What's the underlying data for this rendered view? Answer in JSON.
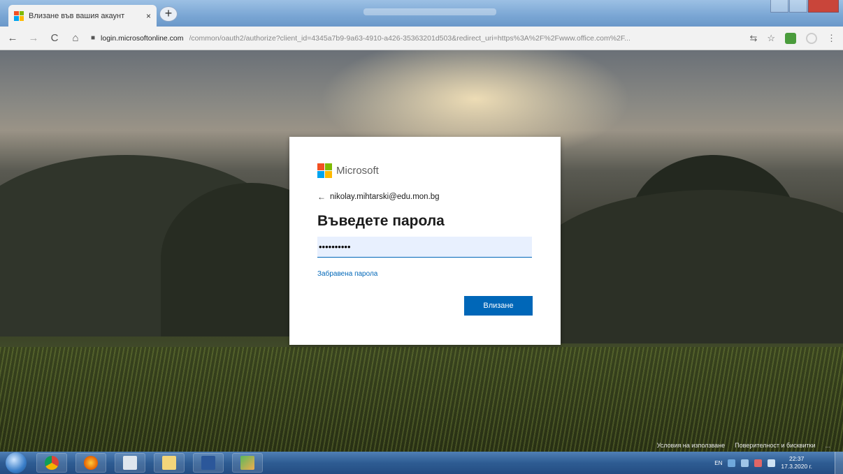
{
  "browser": {
    "tab_title": "Влизане във вашия акаунт",
    "tab_close": "×",
    "new_tab": "+",
    "url_host": "login.microsoftonline.com",
    "url_path": "/common/oauth2/authorize?client_id=4345a7b9-9a63-4910-a426-35363201d503&redirect_uri=https%3A%2F%2Fwww.office.com%2F...",
    "back": "←",
    "forward": "→",
    "reload": "C",
    "home": "⌂",
    "star": "☆",
    "menu": "⋮"
  },
  "login": {
    "brand": "Microsoft",
    "brand_colors": [
      "#f25022",
      "#7fba00",
      "#00a4ef",
      "#ffb900"
    ],
    "back_arrow": "←",
    "account": "nikolay.mihtarski@edu.mon.bg",
    "heading": "Въведете парола",
    "password_value": "••••••••••",
    "forgot_link": "Забравена парола",
    "signin_button": "Влизане",
    "accent_color": "#0067b8"
  },
  "footer": {
    "terms": "Условия на използване",
    "privacy": "Поверителност и бисквитки",
    "more": "..."
  },
  "taskbar": {
    "apps": [
      "chrome-icon",
      "firefox-icon",
      "notepad-icon",
      "explorer-icon",
      "word-icon",
      "paint-icon"
    ],
    "language": "EN",
    "time": "22:37",
    "date": "17.3.2020 г."
  }
}
